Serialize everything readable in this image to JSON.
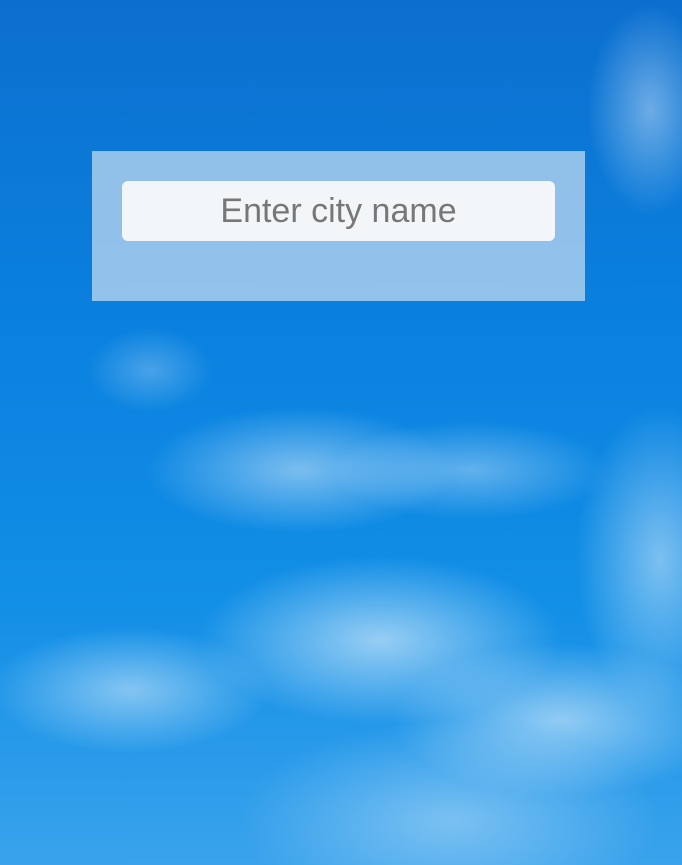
{
  "background": {
    "name": "blue-sky-with-clouds",
    "sky_color": "#0a82e0",
    "cloud_color": "#ffffff"
  },
  "search": {
    "placeholder": "Enter city name",
    "value": "",
    "panel_color": "#ebf0f5"
  }
}
